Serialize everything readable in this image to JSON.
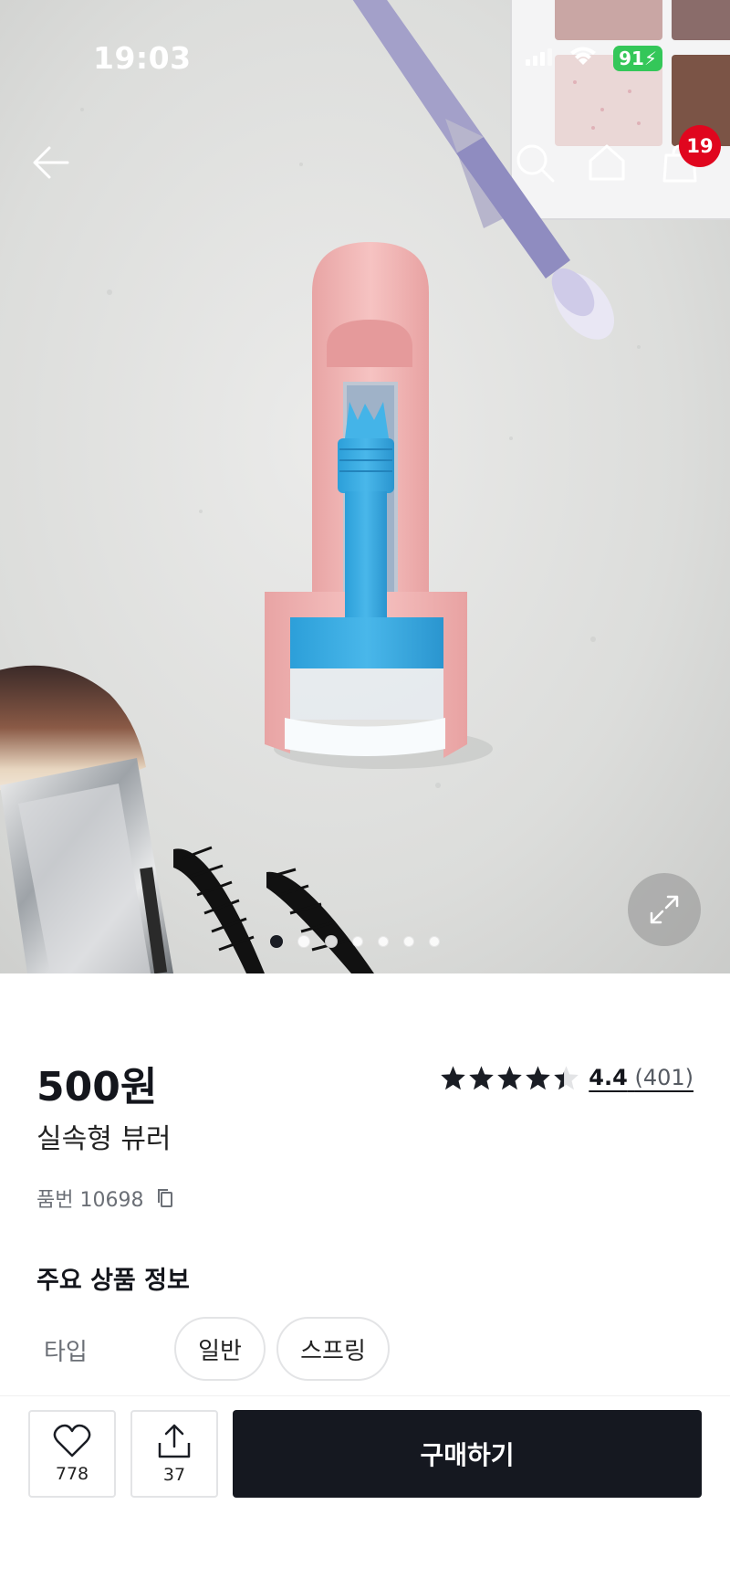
{
  "status_bar": {
    "time": "19:03",
    "battery": "91"
  },
  "nav": {
    "cart_count": "19"
  },
  "gallery": {
    "total_images": 7,
    "active_index": 0
  },
  "product": {
    "price": "500원",
    "name": "실속형 뷰러",
    "sku_label": "품번",
    "sku": "10698",
    "rating": {
      "score": "4.4",
      "count": "(401)",
      "stars_value": 4.4
    }
  },
  "info": {
    "section_title": "주요 상품 정보",
    "type_label": "타입",
    "type_options": [
      "일반",
      "스프링"
    ]
  },
  "actions": {
    "like_count": "778",
    "share_count": "37",
    "buy_label": "구매하기"
  },
  "colors": {
    "accent_dark": "#151820",
    "badge_red": "#e0061e",
    "battery_green": "#34c759"
  }
}
